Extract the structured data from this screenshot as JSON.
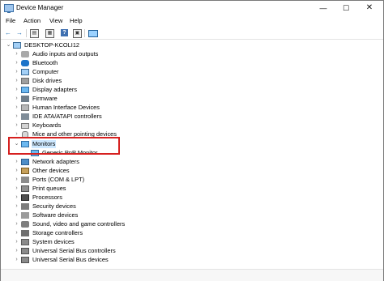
{
  "window": {
    "title": "Device Manager",
    "controls": {
      "minimize": "—",
      "maximize": "☐",
      "close": "✕"
    }
  },
  "menu": [
    "File",
    "Action",
    "View",
    "Help"
  ],
  "toolbar": {
    "back": "←",
    "forward": "→",
    "help": "?"
  },
  "tree": {
    "root": "DESKTOP-KCOLI12",
    "categories": [
      {
        "label": "Audio inputs and outputs",
        "icon": "speaker-icon"
      },
      {
        "label": "Bluetooth",
        "icon": "bluetooth-icon"
      },
      {
        "label": "Computer",
        "icon": "computer-icon"
      },
      {
        "label": "Disk drives",
        "icon": "disk-icon"
      },
      {
        "label": "Display adapters",
        "icon": "display-adapter-icon"
      },
      {
        "label": "Firmware",
        "icon": "firmware-icon"
      },
      {
        "label": "Human Interface Devices",
        "icon": "hid-icon"
      },
      {
        "label": "IDE ATA/ATAPI controllers",
        "icon": "ide-icon"
      },
      {
        "label": "Keyboards",
        "icon": "keyboard-icon"
      },
      {
        "label": "Mice and other pointing devices",
        "icon": "mouse-icon"
      },
      {
        "label": "Monitors",
        "icon": "monitor-icon",
        "expanded": true,
        "children": [
          "Generic PnP Monitor"
        ]
      },
      {
        "label": "Network adapters",
        "icon": "network-icon"
      },
      {
        "label": "Other devices",
        "icon": "other-devices-icon"
      },
      {
        "label": "Ports (COM & LPT)",
        "icon": "ports-icon"
      },
      {
        "label": "Print queues",
        "icon": "printer-icon"
      },
      {
        "label": "Processors",
        "icon": "processor-icon"
      },
      {
        "label": "Security devices",
        "icon": "security-icon"
      },
      {
        "label": "Software devices",
        "icon": "software-icon"
      },
      {
        "label": "Sound, video and game controllers",
        "icon": "sound-icon"
      },
      {
        "label": "Storage controllers",
        "icon": "storage-icon"
      },
      {
        "label": "System devices",
        "icon": "system-icon"
      },
      {
        "label": "Universal Serial Bus controllers",
        "icon": "usb-icon"
      },
      {
        "label": "Universal Serial Bus devices",
        "icon": "usb-icon"
      }
    ]
  },
  "colors": {
    "highlight_border": "#d6201f",
    "selection": "#cde8ff"
  }
}
